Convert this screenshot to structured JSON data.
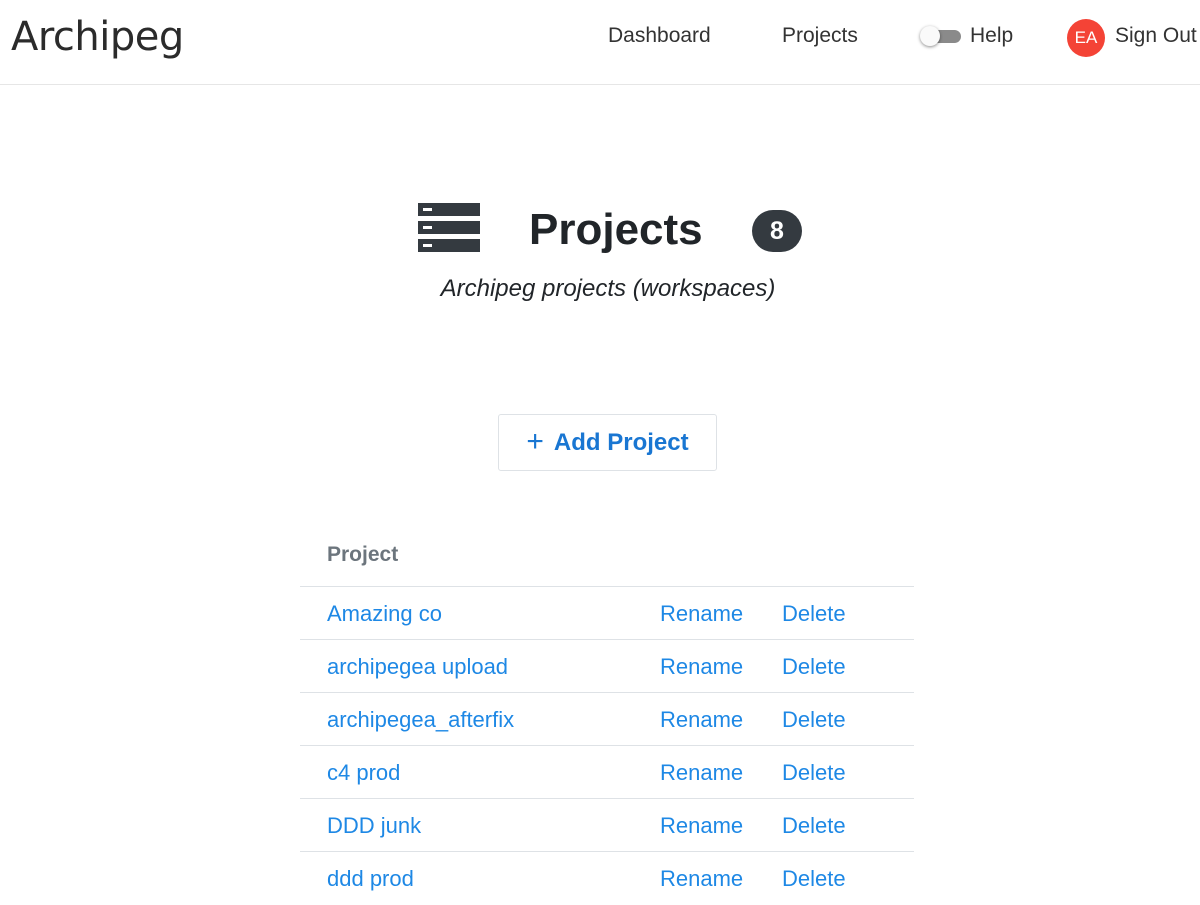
{
  "navbar": {
    "brand": "Archipeg",
    "dashboard_label": "Dashboard",
    "projects_label": "Projects",
    "help_label": "Help",
    "avatar_initials": "EA",
    "signout_label": "Sign Out"
  },
  "header": {
    "icon": "server-icon",
    "title": "Projects",
    "count": "8",
    "subtitle": "Archipeg projects (workspaces)"
  },
  "add_button": {
    "icon": "plus-icon",
    "label": "Add Project"
  },
  "table": {
    "header": "Project",
    "rename_label": "Rename",
    "delete_label": "Delete",
    "rows": [
      {
        "name": "Amazing co"
      },
      {
        "name": "archipegea upload"
      },
      {
        "name": "archipegea_afterfix"
      },
      {
        "name": "c4 prod"
      },
      {
        "name": "DDD junk"
      },
      {
        "name": "ddd prod"
      }
    ]
  },
  "colors": {
    "link": "#1e88e5",
    "avatar": "#f44336",
    "badge": "#343a40"
  }
}
